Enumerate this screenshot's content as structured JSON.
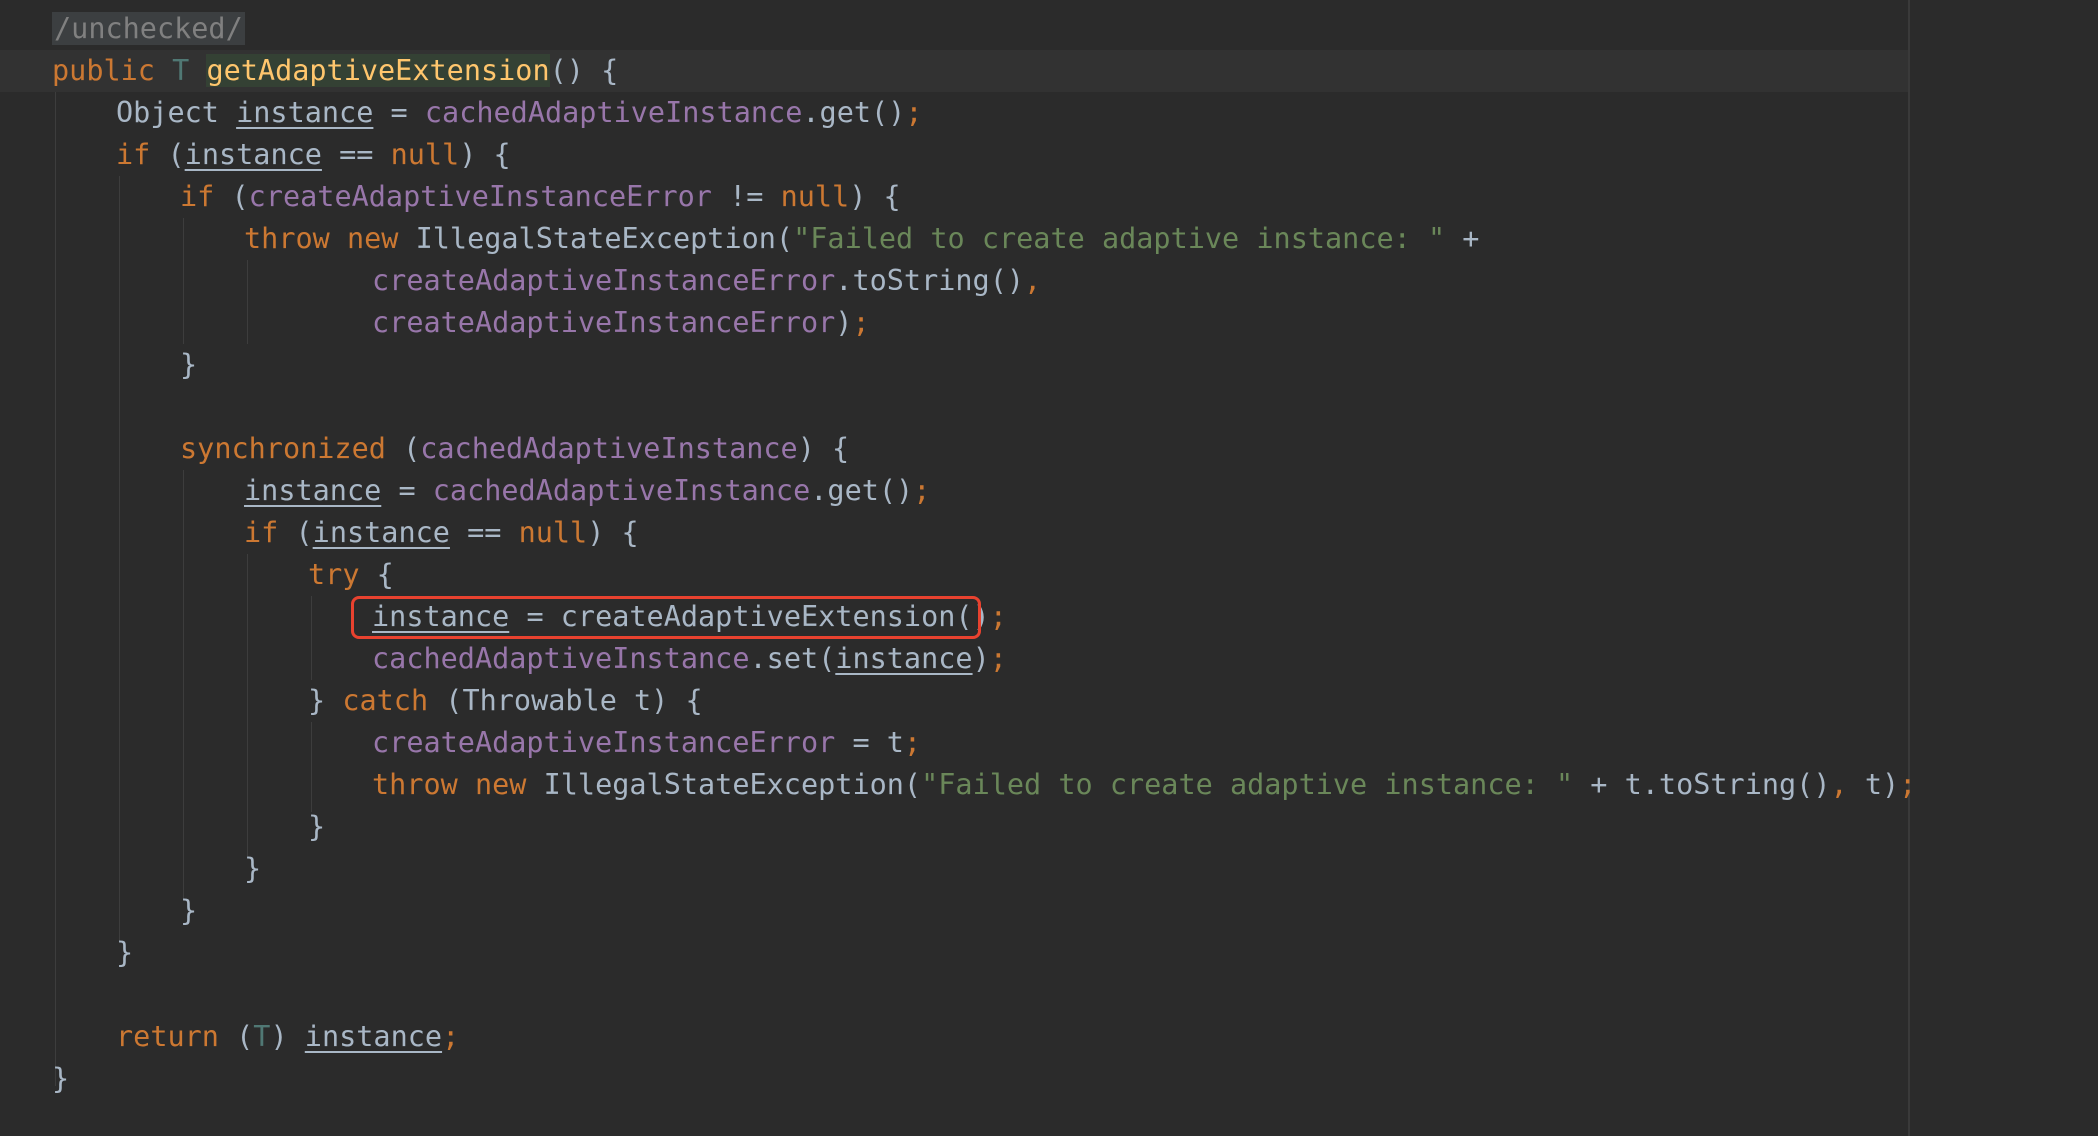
{
  "colors": {
    "background": "#2b2b2b",
    "keyword": "#cc7832",
    "plain": "#a9b7c6",
    "field": "#9876aa",
    "string": "#6a8759",
    "type_param": "#507874",
    "method_decl": "#ffc66d",
    "highlight_box": "#e8422f"
  },
  "code": {
    "lines": [
      {
        "indent": 0,
        "tokens": [
          {
            "t": "/unchecked/",
            "c": "ann"
          }
        ]
      },
      {
        "indent": 0,
        "tokens": [
          {
            "t": "public ",
            "c": "kw"
          },
          {
            "t": "T ",
            "c": "tp"
          },
          {
            "t": "getAdaptiveExtension",
            "c": "mdecl hl-method"
          },
          {
            "t": "() {",
            "c": "pl"
          }
        ]
      },
      {
        "indent": 1,
        "tokens": [
          {
            "t": "Object ",
            "c": "pl"
          },
          {
            "t": "instance",
            "c": "pl und"
          },
          {
            "t": " = ",
            "c": "pl"
          },
          {
            "t": "cachedAdaptiveInstance",
            "c": "fld"
          },
          {
            "t": ".get()",
            "c": "pl"
          },
          {
            "t": ";",
            "c": "semi"
          }
        ]
      },
      {
        "indent": 1,
        "tokens": [
          {
            "t": "if ",
            "c": "kw"
          },
          {
            "t": "(",
            "c": "pl"
          },
          {
            "t": "instance",
            "c": "pl und"
          },
          {
            "t": " == ",
            "c": "pl"
          },
          {
            "t": "null",
            "c": "kw"
          },
          {
            "t": ") {",
            "c": "pl"
          }
        ]
      },
      {
        "indent": 2,
        "tokens": [
          {
            "t": "if ",
            "c": "kw"
          },
          {
            "t": "(",
            "c": "pl"
          },
          {
            "t": "createAdaptiveInstanceError",
            "c": "fld"
          },
          {
            "t": " != ",
            "c": "pl"
          },
          {
            "t": "null",
            "c": "kw"
          },
          {
            "t": ") {",
            "c": "pl"
          }
        ]
      },
      {
        "indent": 3,
        "tokens": [
          {
            "t": "throw new ",
            "c": "kw"
          },
          {
            "t": "IllegalStateException(",
            "c": "pl"
          },
          {
            "t": "\"Failed to create adaptive instance: \"",
            "c": "str"
          },
          {
            "t": " +",
            "c": "pl"
          }
        ]
      },
      {
        "indent": 5,
        "tokens": [
          {
            "t": "createAdaptiveInstanceError",
            "c": "fld"
          },
          {
            "t": ".toString()",
            "c": "pl"
          },
          {
            "t": ",",
            "c": "semi"
          }
        ]
      },
      {
        "indent": 5,
        "tokens": [
          {
            "t": "createAdaptiveInstanceError",
            "c": "fld"
          },
          {
            "t": ")",
            "c": "pl"
          },
          {
            "t": ";",
            "c": "semi"
          }
        ]
      },
      {
        "indent": 2,
        "tokens": [
          {
            "t": "}",
            "c": "pl"
          }
        ]
      },
      {
        "indent": 0,
        "tokens": []
      },
      {
        "indent": 2,
        "tokens": [
          {
            "t": "synchronized ",
            "c": "kw"
          },
          {
            "t": "(",
            "c": "pl"
          },
          {
            "t": "cachedAdaptiveInstance",
            "c": "fld"
          },
          {
            "t": ") {",
            "c": "pl"
          }
        ]
      },
      {
        "indent": 3,
        "tokens": [
          {
            "t": "instance",
            "c": "pl und"
          },
          {
            "t": " = ",
            "c": "pl"
          },
          {
            "t": "cachedAdaptiveInstance",
            "c": "fld"
          },
          {
            "t": ".get()",
            "c": "pl"
          },
          {
            "t": ";",
            "c": "semi"
          }
        ]
      },
      {
        "indent": 3,
        "tokens": [
          {
            "t": "if ",
            "c": "kw"
          },
          {
            "t": "(",
            "c": "pl"
          },
          {
            "t": "instance",
            "c": "pl und"
          },
          {
            "t": " == ",
            "c": "pl"
          },
          {
            "t": "null",
            "c": "kw"
          },
          {
            "t": ") {",
            "c": "pl"
          }
        ]
      },
      {
        "indent": 4,
        "tokens": [
          {
            "t": "try ",
            "c": "kw"
          },
          {
            "t": "{",
            "c": "pl"
          }
        ]
      },
      {
        "indent": 5,
        "tokens": [
          {
            "t": "instance",
            "c": "pl und"
          },
          {
            "t": " = createAdaptiveExtension()",
            "c": "pl"
          },
          {
            "t": ";",
            "c": "semi"
          }
        ]
      },
      {
        "indent": 5,
        "tokens": [
          {
            "t": "cachedAdaptiveInstance",
            "c": "fld"
          },
          {
            "t": ".set(",
            "c": "pl"
          },
          {
            "t": "instance",
            "c": "pl und"
          },
          {
            "t": ")",
            "c": "pl"
          },
          {
            "t": ";",
            "c": "semi"
          }
        ]
      },
      {
        "indent": 4,
        "tokens": [
          {
            "t": "} ",
            "c": "pl"
          },
          {
            "t": "catch ",
            "c": "kw"
          },
          {
            "t": "(Throwable t) {",
            "c": "pl"
          }
        ]
      },
      {
        "indent": 5,
        "tokens": [
          {
            "t": "createAdaptiveInstanceError",
            "c": "fld"
          },
          {
            "t": " = t",
            "c": "pl"
          },
          {
            "t": ";",
            "c": "semi"
          }
        ]
      },
      {
        "indent": 5,
        "tokens": [
          {
            "t": "throw new ",
            "c": "kw"
          },
          {
            "t": "IllegalStateException(",
            "c": "pl"
          },
          {
            "t": "\"Failed to create adaptive instance: \"",
            "c": "str"
          },
          {
            "t": " + t.toString()",
            "c": "pl"
          },
          {
            "t": ", ",
            "c": "semi"
          },
          {
            "t": "t)",
            "c": "pl"
          },
          {
            "t": ";",
            "c": "semi"
          }
        ]
      },
      {
        "indent": 4,
        "tokens": [
          {
            "t": "}",
            "c": "pl"
          }
        ]
      },
      {
        "indent": 3,
        "tokens": [
          {
            "t": "}",
            "c": "pl"
          }
        ]
      },
      {
        "indent": 2,
        "tokens": [
          {
            "t": "}",
            "c": "pl"
          }
        ]
      },
      {
        "indent": 1,
        "tokens": [
          {
            "t": "}",
            "c": "pl"
          }
        ]
      },
      {
        "indent": 0,
        "tokens": []
      },
      {
        "indent": 1,
        "tokens": [
          {
            "t": "return ",
            "c": "kw"
          },
          {
            "t": "(",
            "c": "pl"
          },
          {
            "t": "T",
            "c": "tp"
          },
          {
            "t": ") ",
            "c": "pl"
          },
          {
            "t": "instance",
            "c": "pl und"
          },
          {
            "t": ";",
            "c": "semi"
          }
        ]
      },
      {
        "indent": 0,
        "tokens": [
          {
            "t": "}",
            "c": "pl"
          }
        ]
      }
    ]
  }
}
